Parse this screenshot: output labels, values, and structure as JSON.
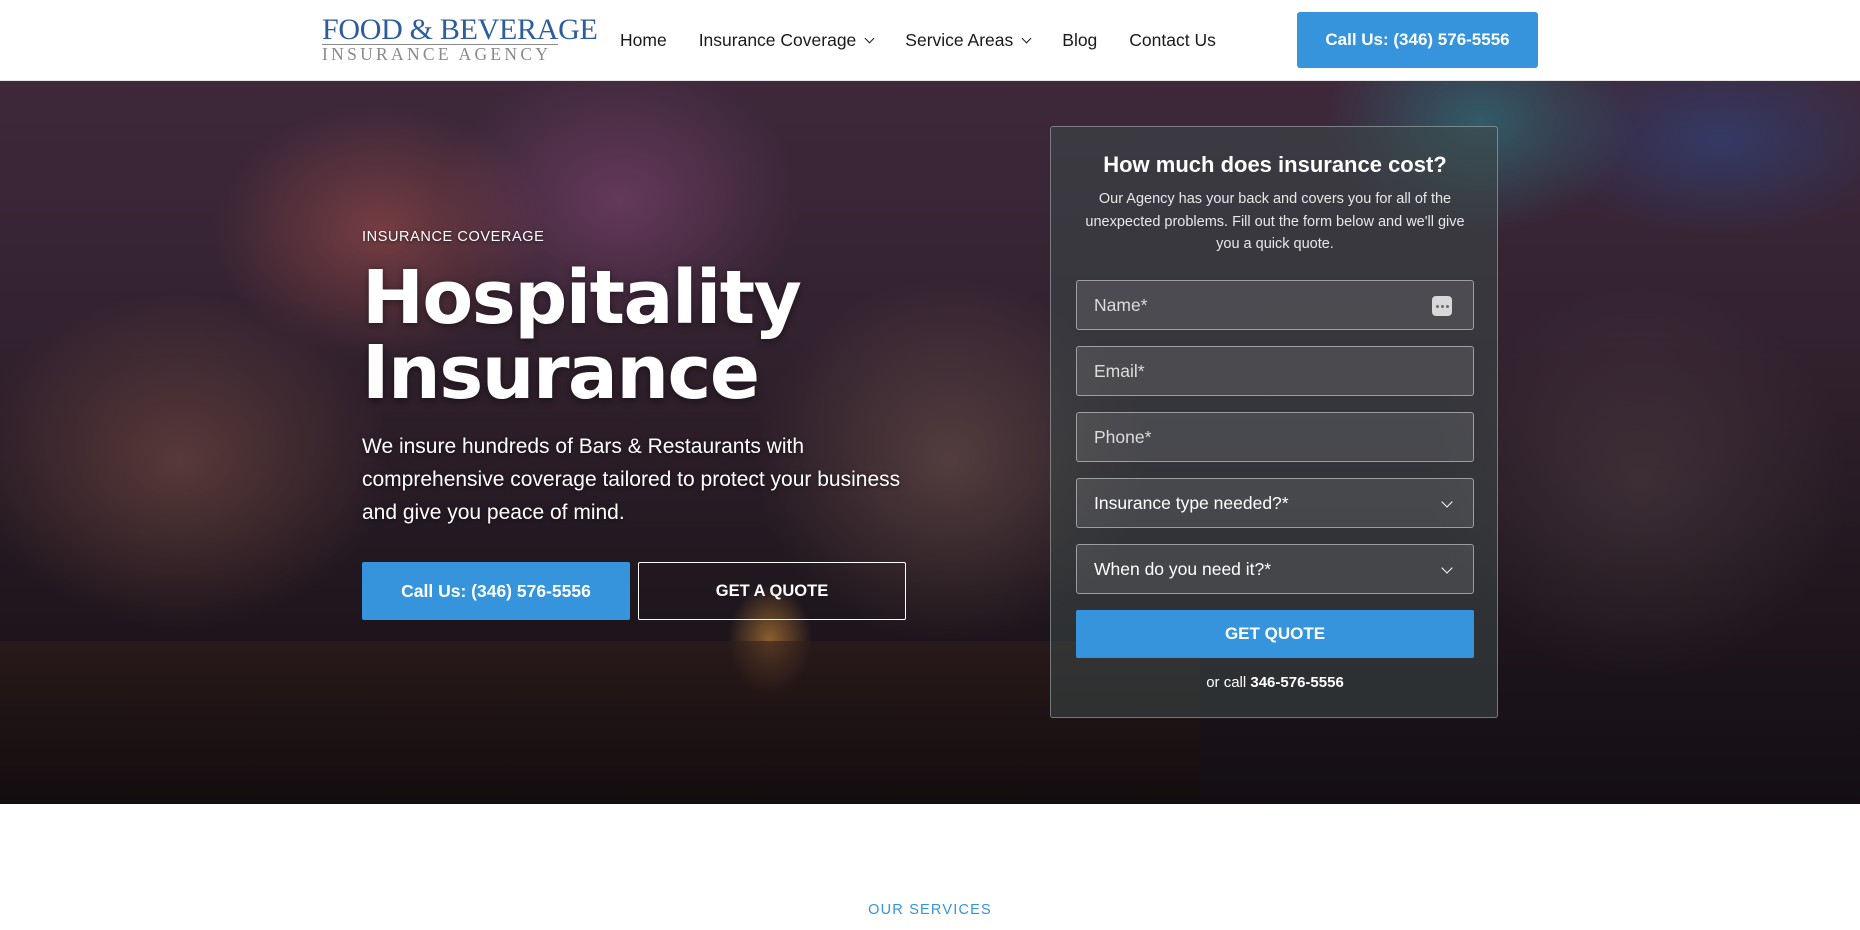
{
  "header": {
    "logo": {
      "line1": "Food & Beverage",
      "line2": "Insurance Agency"
    },
    "nav": [
      {
        "label": "Home",
        "has_dropdown": false
      },
      {
        "label": "Insurance Coverage",
        "has_dropdown": true
      },
      {
        "label": "Service Areas",
        "has_dropdown": true
      },
      {
        "label": "Blog",
        "has_dropdown": false
      },
      {
        "label": "Contact Us",
        "has_dropdown": false
      }
    ],
    "cta_label": "Call Us: (346) 576-5556"
  },
  "hero": {
    "eyebrow": "INSURANCE COVERAGE",
    "title": "Hospitality Insurance",
    "description": "We insure hundreds of Bars & Restaurants with comprehensive coverage tailored to protect your business and give you peace of mind.",
    "call_button": "Call Us: (346) 576-5556",
    "quote_button": "GET A QUOTE"
  },
  "quote_form": {
    "title": "How much does insurance cost?",
    "subtitle": "Our Agency has your back and covers you for all of the unexpected problems. Fill out the form below and we'll give you a quick quote.",
    "name_placeholder": "Name*",
    "email_placeholder": "Email*",
    "phone_placeholder": "Phone*",
    "type_select": "Insurance type needed?*",
    "when_select": "When do you need it?*",
    "submit_label": "GET QUOTE",
    "or_call_prefix": "or call",
    "or_call_number": "346-576-5556"
  },
  "services": {
    "label": "OUR SERVICES"
  },
  "colors": {
    "accent": "#3594db",
    "logo_blue": "#2d5d9c",
    "logo_gray": "#8a8a8a"
  }
}
